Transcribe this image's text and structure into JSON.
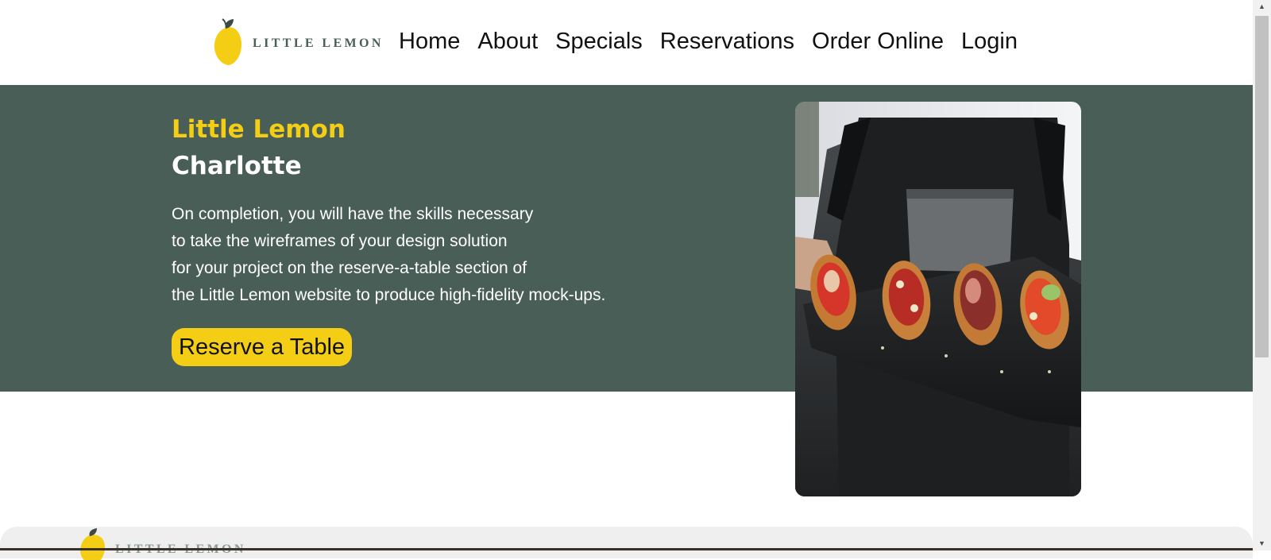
{
  "header": {
    "logo_text": "LITTLE LEMON",
    "nav": [
      "Home",
      "About",
      "Specials",
      "Reservations",
      "Order Online",
      "Login"
    ]
  },
  "hero": {
    "title": "Little Lemon",
    "subtitle": "Charlotte",
    "description_lines": [
      "On completion, you will have the skills necessary",
      "to take the wireframes of your design solution",
      "for your project on the reserve-a-table section of",
      "the Little Lemon website to produce high-fidelity mock-ups."
    ],
    "cta_label": "Reserve a Table",
    "image_icon": "hero-food-photo"
  },
  "footer": {
    "logo_text": "LITTLE LEMON"
  },
  "scrollbar": {
    "up_icon": "scroll-up-arrow-icon",
    "down_icon": "scroll-down-arrow-icon"
  },
  "colors": {
    "primary_green": "#495e57",
    "primary_yellow": "#f4ce14",
    "footer_bg": "#eeefee"
  }
}
